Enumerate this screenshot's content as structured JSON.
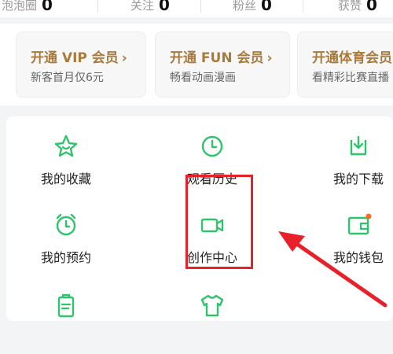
{
  "stats": [
    {
      "label": "泡泡圈",
      "value": "0"
    },
    {
      "label": "关注",
      "value": "0"
    },
    {
      "label": "粉丝",
      "value": "0"
    },
    {
      "label": "获赞",
      "value": "0"
    }
  ],
  "memberships": [
    {
      "title": "开通 VIP 会员",
      "subtitle": "新客首月仅6元"
    },
    {
      "title": "开通 FUN 会员",
      "subtitle": "畅看动画漫画"
    },
    {
      "title": "开通体育会员",
      "subtitle": "看精彩比赛直播"
    }
  ],
  "grid": {
    "items": [
      {
        "label": "我的收藏",
        "icon": "star-icon"
      },
      {
        "label": "观看历史",
        "icon": "clock-icon"
      },
      {
        "label": "我的下载",
        "icon": "download-icon"
      },
      {
        "label": "我的预约",
        "icon": "alarm-clock-icon"
      },
      {
        "label": "创作中心",
        "icon": "video-camera-icon"
      },
      {
        "label": "我的钱包",
        "icon": "wallet-icon"
      },
      {
        "label": "",
        "icon": "clipboard-icon"
      },
      {
        "label": "",
        "icon": "shirt-icon"
      }
    ]
  },
  "colors": {
    "accent_green": "#2fc46b",
    "gold": "#a87b3d",
    "annotation_red": "#e8202a"
  }
}
